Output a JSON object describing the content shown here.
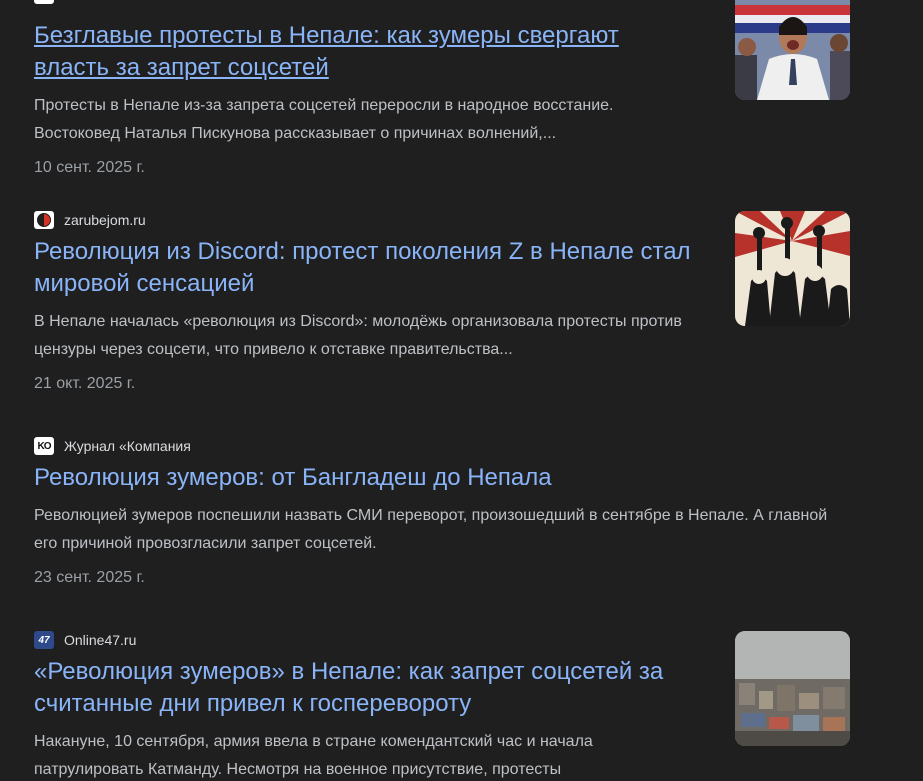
{
  "results": [
    {
      "title": "Безглавые протесты в Непале: как зумеры свергают власть за запрет соцсетей",
      "snippet": "Протесты в Непале из-за запрета соцсетей переросли в народное восстание. Востоковед Наталья Пискунова рассказывает о причинах волнений,...",
      "date": "10 сент. 2025 г."
    },
    {
      "source": "zarubejom.ru",
      "title": "Революция из Discord: протест поколения Z в Непале стал мировой сенсацией",
      "snippet": "В Непале началась «революция из Discord»: молодёжь организовала протесты против цензуры через соцсети, что привело к отставке правительства...",
      "date": "21 окт. 2025 г."
    },
    {
      "source": "Журнал «Компания",
      "title": "Революция зумеров: от Бангладеш до Непала",
      "snippet": "Революцией зумеров поспешили назвать СМИ переворот, произошедший в сентябре в Непале. А главной его причиной провозгласили запрет соцсетей.",
      "date": "23 сент. 2025 г."
    },
    {
      "source": "Online47.ru",
      "title": "«Революция зумеров» в Непале: как запрет соцсетей за считанные дни привел к госперевороту",
      "snippet": "Накануне, 10 сентября, армия ввела в стране комендантский час и начала патрулировать Катманду. Несмотря на военное присутствие, протесты"
    }
  ],
  "colors": {
    "background": "#1f1f1f",
    "link": "#8ab4f8",
    "text": "#bdc1c6",
    "muted": "#9aa0a6"
  }
}
